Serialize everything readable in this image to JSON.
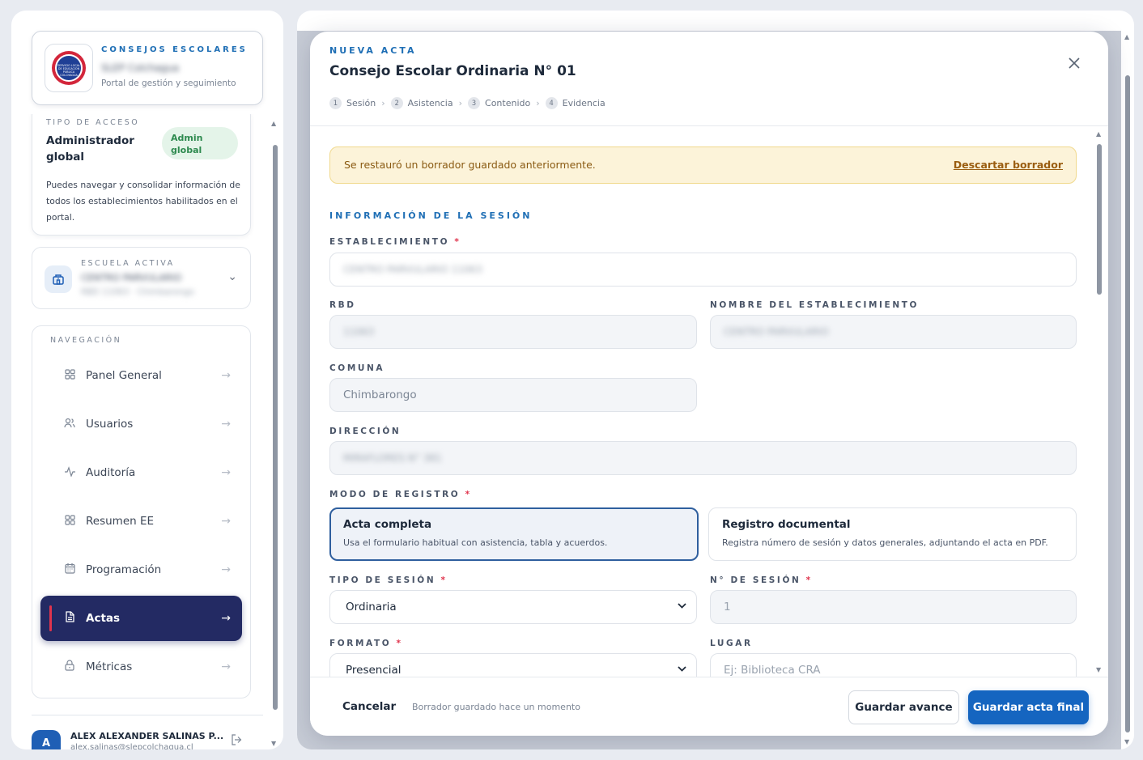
{
  "brand": {
    "eyebrow": "CONSEJOS ESCOLARES",
    "name": "SLEP Colchagua",
    "subtitle": "Portal de gestión y seguimiento",
    "logo_text": "SERVICIO LOCAL DE EDUCACIÓN PÚBLICA COLCHAGUA"
  },
  "access": {
    "eyebrow": "TIPO DE ACCESO",
    "title": "Administrador global",
    "badge": "Admin global",
    "description": "Puedes navegar y consolidar información de todos los establecimientos habilitados en el portal."
  },
  "school": {
    "eyebrow": "ESCUELA ACTIVA",
    "name": "CENTRO PARVULARIO",
    "sub": "RBD 11063 · Chimbarongo"
  },
  "nav": {
    "eyebrow": "NAVEGACIÓN",
    "items": [
      {
        "label": "Panel General",
        "icon": "grid-icon"
      },
      {
        "label": "Usuarios",
        "icon": "users-icon"
      },
      {
        "label": "Auditoría",
        "icon": "activity-icon"
      },
      {
        "label": "Resumen EE",
        "icon": "grid-icon"
      },
      {
        "label": "Programación",
        "icon": "calendar-icon"
      },
      {
        "label": "Actas",
        "icon": "document-icon",
        "active": true
      },
      {
        "label": "Métricas",
        "icon": "lock-icon"
      }
    ]
  },
  "user": {
    "avatar_initial": "A",
    "name": "ALEX ALEXANDER SALINAS P...",
    "email": "alex.salinas@slepcolchagua.cl"
  },
  "modal": {
    "eyebrow": "NUEVA ACTA",
    "title": "Consejo Escolar Ordinaria N° 01",
    "steps": [
      {
        "num": "1",
        "label": "Sesión"
      },
      {
        "num": "2",
        "label": "Asistencia"
      },
      {
        "num": "3",
        "label": "Contenido"
      },
      {
        "num": "4",
        "label": "Evidencia"
      }
    ],
    "step_separator": "›",
    "draft_alert": {
      "text": "Se restauró un borrador guardado anteriormente.",
      "action": "Descartar borrador"
    },
    "section_title": "INFORMACIÓN DE LA SESIÓN",
    "fields": {
      "establecimiento": {
        "label": "ESTABLECIMIENTO",
        "value": "CENTRO PARVULARIO 11063"
      },
      "rbd": {
        "label": "RBD",
        "value": "11063"
      },
      "nombre": {
        "label": "NOMBRE DEL ESTABLECIMIENTO",
        "value": "CENTRO PARVULARIO"
      },
      "comuna": {
        "label": "COMUNA",
        "value": "Chimbarongo"
      },
      "direccion": {
        "label": "DIRECCIÓN",
        "value": "MIRAFLORES N° 381"
      },
      "modo": {
        "label": "MODO DE REGISTRO"
      },
      "tipo_sesion": {
        "label": "TIPO DE SESIÓN",
        "value": "Ordinaria"
      },
      "numero_sesion": {
        "label": "N° DE SESIÓN",
        "value": "1"
      },
      "formato": {
        "label": "FORMATO",
        "value": "Presencial"
      },
      "lugar": {
        "label": "LUGAR",
        "placeholder": "Ej: Biblioteca CRA"
      }
    },
    "modes": [
      {
        "title": "Acta completa",
        "description": "Usa el formulario habitual con asistencia, tabla y acuerdos.",
        "selected": true
      },
      {
        "title": "Registro documental",
        "description": "Registra número de sesión y datos generales, adjuntando el acta en PDF.",
        "selected": false
      }
    ],
    "footer": {
      "cancel": "Cancelar",
      "status": "Borrador guardado hace un momento",
      "save_progress": "Guardar avance",
      "save_final": "Guardar acta final"
    }
  },
  "colors": {
    "accent": "#1565c0",
    "nav_active": "#232a63",
    "active_marker": "#e0344d",
    "alert_bg": "#fcf3d9",
    "badge_green": "#2e8a4f"
  }
}
